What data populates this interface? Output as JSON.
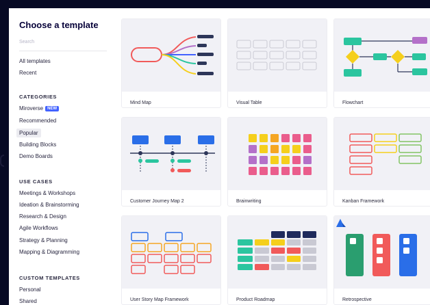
{
  "sidebar": {
    "title": "Choose a template",
    "search_placeholder": "Search",
    "nav": [
      "All templates",
      "Recent"
    ],
    "categories_heading": "CATEGORIES",
    "categories": [
      {
        "label": "Miroverse",
        "badge": "NEW"
      },
      {
        "label": "Recommended"
      },
      {
        "label": "Popular",
        "active": true
      },
      {
        "label": "Building Blocks"
      },
      {
        "label": "Demo Boards"
      }
    ],
    "use_cases_heading": "USE CASES",
    "use_cases": [
      "Meetings & Workshops",
      "Ideation & Brainstorming",
      "Research & Design",
      "Agile Workflows",
      "Strategy & Planning",
      "Mapping & Diagramming"
    ],
    "custom_heading": "CUSTOM TEMPLATES",
    "custom": [
      "Personal",
      "Shared"
    ]
  },
  "templates": [
    {
      "label": "Mind Map",
      "icon": "mind-map-thumbnail"
    },
    {
      "label": "Visual Table",
      "icon": "visual-table-thumbnail"
    },
    {
      "label": "Flowchart",
      "icon": "flowchart-thumbnail"
    },
    {
      "label": "Customer Journey Map 2",
      "icon": "customer-journey-map-thumbnail"
    },
    {
      "label": "Brainwriting",
      "icon": "brainwriting-thumbnail"
    },
    {
      "label": "Kanban Framework",
      "icon": "kanban-thumbnail"
    },
    {
      "label": "User Story Map Framework",
      "icon": "user-story-map-thumbnail"
    },
    {
      "label": "Product Roadmap",
      "icon": "product-roadmap-thumbnail"
    },
    {
      "label": "Retrospective",
      "icon": "retrospective-thumbnail",
      "logo": "atlassian-logo-icon"
    }
  ],
  "colors": {
    "page_bg": "#070a24",
    "brand_blue": "#4262ff",
    "navy": "#2d3659",
    "coral": "#f15a5a",
    "teal": "#2bc59f",
    "yellow": "#f5cf1c",
    "purple": "#b470c9",
    "green": "#82c464",
    "blue": "#2a6ee8"
  }
}
